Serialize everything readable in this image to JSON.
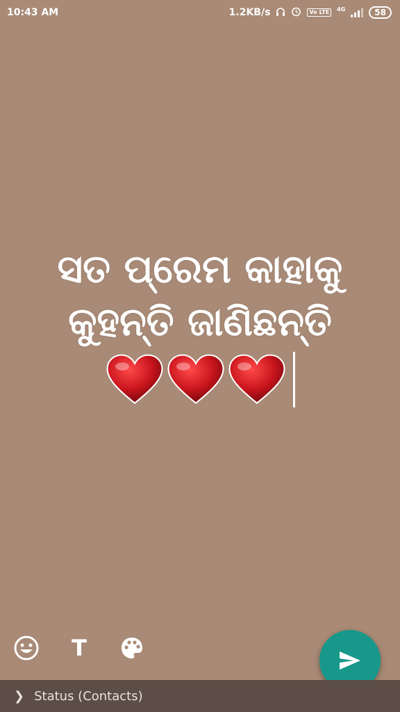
{
  "status_bar": {
    "time": "10:43 AM",
    "speed": "1.2KB/s",
    "headphones_icon": "headphones-icon",
    "alarm_icon": "alarm-icon",
    "vo_lte_label": "Vo LTE",
    "network_label": "4G",
    "battery": "58"
  },
  "composer": {
    "text_line_1": "ସତ ପ୍ରେମ କାହାକୁ",
    "text_line_2": "କୁହନ୍ତି ଜାଣିଛନ୍ତି",
    "heart_count": 3,
    "background_color": "#a88a76"
  },
  "toolbar": {
    "emoji_icon": "emoji-icon",
    "text_icon_label": "T",
    "palette_icon": "palette-icon"
  },
  "send_button": {
    "icon": "send-icon",
    "color": "#17988a"
  },
  "bottom_bar": {
    "audience_label": "Status (Contacts)"
  }
}
